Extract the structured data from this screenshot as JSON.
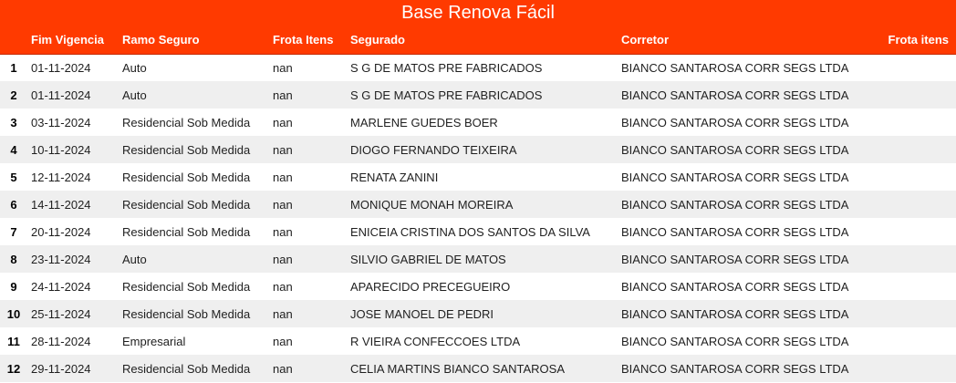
{
  "title": "Base Renova Fácil",
  "colors": {
    "header_bg": "#ff3a00",
    "header_text": "#ffffff",
    "row_alt_bg": "#efefef"
  },
  "columns": [
    "",
    "Fim Vigencia",
    "Ramo Seguro",
    "Frota Itens",
    "Segurado",
    "Corretor",
    "Frota itens"
  ],
  "rows": [
    {
      "idx": "1",
      "fim": "01-11-2024",
      "ramo": "Auto",
      "frota": "nan",
      "segurado": "S G DE MATOS PRE FABRICADOS",
      "corretor": "BIANCO SANTAROSA CORR SEGS LTDA",
      "frota2": ""
    },
    {
      "idx": "2",
      "fim": "01-11-2024",
      "ramo": "Auto",
      "frota": "nan",
      "segurado": "S G DE MATOS PRE FABRICADOS",
      "corretor": "BIANCO SANTAROSA CORR SEGS LTDA",
      "frota2": ""
    },
    {
      "idx": "3",
      "fim": "03-11-2024",
      "ramo": "Residencial Sob Medida",
      "frota": "nan",
      "segurado": "MARLENE GUEDES BOER",
      "corretor": "BIANCO SANTAROSA CORR SEGS LTDA",
      "frota2": ""
    },
    {
      "idx": "4",
      "fim": "10-11-2024",
      "ramo": "Residencial Sob Medida",
      "frota": "nan",
      "segurado": "DIOGO FERNANDO TEIXEIRA",
      "corretor": "BIANCO SANTAROSA CORR SEGS LTDA",
      "frota2": ""
    },
    {
      "idx": "5",
      "fim": "12-11-2024",
      "ramo": "Residencial Sob Medida",
      "frota": "nan",
      "segurado": "RENATA ZANINI",
      "corretor": "BIANCO SANTAROSA CORR SEGS LTDA",
      "frota2": ""
    },
    {
      "idx": "6",
      "fim": "14-11-2024",
      "ramo": "Residencial Sob Medida",
      "frota": "nan",
      "segurado": "MONIQUE MONAH MOREIRA",
      "corretor": "BIANCO SANTAROSA CORR SEGS LTDA",
      "frota2": ""
    },
    {
      "idx": "7",
      "fim": "20-11-2024",
      "ramo": "Residencial Sob Medida",
      "frota": "nan",
      "segurado": "ENICEIA CRISTINA DOS SANTOS DA SILVA",
      "corretor": "BIANCO SANTAROSA CORR SEGS LTDA",
      "frota2": ""
    },
    {
      "idx": "8",
      "fim": "23-11-2024",
      "ramo": "Auto",
      "frota": "nan",
      "segurado": "SILVIO GABRIEL DE MATOS",
      "corretor": "BIANCO SANTAROSA CORR SEGS LTDA",
      "frota2": ""
    },
    {
      "idx": "9",
      "fim": "24-11-2024",
      "ramo": "Residencial Sob Medida",
      "frota": "nan",
      "segurado": "APARECIDO PRECEGUEIRO",
      "corretor": "BIANCO SANTAROSA CORR SEGS LTDA",
      "frota2": ""
    },
    {
      "idx": "10",
      "fim": "25-11-2024",
      "ramo": "Residencial Sob Medida",
      "frota": "nan",
      "segurado": "JOSE MANOEL DE PEDRI",
      "corretor": "BIANCO SANTAROSA CORR SEGS LTDA",
      "frota2": ""
    },
    {
      "idx": "11",
      "fim": "28-11-2024",
      "ramo": "Empresarial",
      "frota": "nan",
      "segurado": "R VIEIRA CONFECCOES LTDA",
      "corretor": "BIANCO SANTAROSA CORR SEGS LTDA",
      "frota2": ""
    },
    {
      "idx": "12",
      "fim": "29-11-2024",
      "ramo": "Residencial Sob Medida",
      "frota": "nan",
      "segurado": "CELIA MARTINS BIANCO SANTAROSA",
      "corretor": "BIANCO SANTAROSA CORR SEGS LTDA",
      "frota2": ""
    }
  ]
}
